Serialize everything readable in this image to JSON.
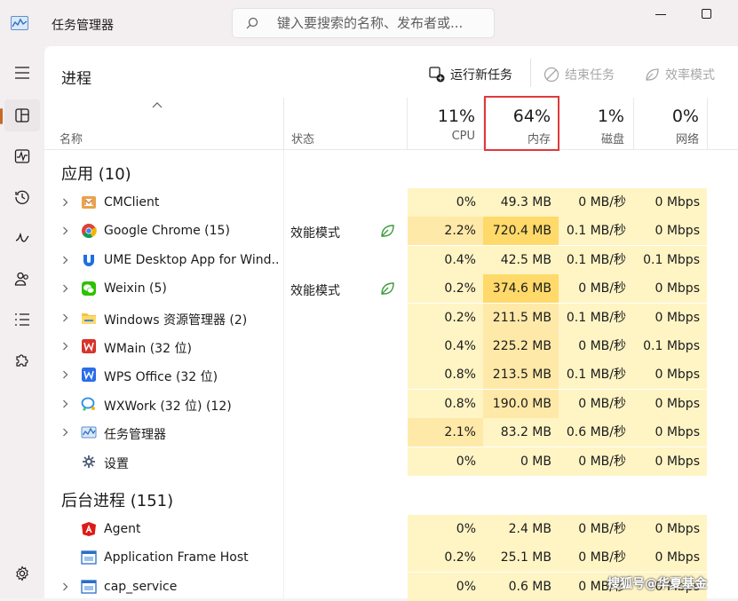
{
  "app": {
    "title": "任务管理器"
  },
  "search": {
    "placeholder": "键入要搜索的名称、发布者或..."
  },
  "page": {
    "title": "进程"
  },
  "commands": {
    "run_new_task": "运行新任务",
    "end_task": "结束任务",
    "efficiency_mode": "效率模式"
  },
  "header": {
    "name": "名称",
    "status": "状态",
    "cpu": {
      "percent": "11%",
      "label": "CPU"
    },
    "memory": {
      "percent": "64%",
      "label": "内存"
    },
    "disk": {
      "percent": "1%",
      "label": "磁盘"
    },
    "network": {
      "percent": "0%",
      "label": "网络"
    }
  },
  "groups": {
    "apps": "应用 (10)",
    "background": "后台进程 (151)"
  },
  "apps": [
    {
      "name": "CMClient",
      "icon": "cmclient-icon",
      "status": "",
      "cpu": "0%",
      "memory": "49.3 MB",
      "disk": "0 MB/秒",
      "network": "0 Mbps"
    },
    {
      "name": "Google Chrome (15)",
      "icon": "chrome-icon",
      "status": "效能模式",
      "cpu": "2.2%",
      "memory": "720.4 MB",
      "disk": "0.1 MB/秒",
      "network": "0 Mbps"
    },
    {
      "name": "UME Desktop App for Wind...",
      "icon": "ume-icon",
      "status": "",
      "cpu": "0.4%",
      "memory": "42.5 MB",
      "disk": "0.1 MB/秒",
      "network": "0.1 Mbps"
    },
    {
      "name": "Weixin (5)",
      "icon": "weixin-icon",
      "status": "效能模式",
      "cpu": "0.2%",
      "memory": "374.6 MB",
      "disk": "0 MB/秒",
      "network": "0 Mbps"
    },
    {
      "name": "Windows 资源管理器 (2)",
      "icon": "explorer-icon",
      "status": "",
      "cpu": "0.2%",
      "memory": "211.5 MB",
      "disk": "0.1 MB/秒",
      "network": "0 Mbps"
    },
    {
      "name": "WMain (32 位)",
      "icon": "wmain-icon",
      "status": "",
      "cpu": "0.4%",
      "memory": "225.2 MB",
      "disk": "0 MB/秒",
      "network": "0.1 Mbps"
    },
    {
      "name": "WPS Office (32 位)",
      "icon": "wps-icon",
      "status": "",
      "cpu": "0.8%",
      "memory": "213.5 MB",
      "disk": "0.1 MB/秒",
      "network": "0 Mbps"
    },
    {
      "name": "WXWork (32 位) (12)",
      "icon": "wxwork-icon",
      "status": "",
      "cpu": "0.8%",
      "memory": "190.0 MB",
      "disk": "0 MB/秒",
      "network": "0 Mbps"
    },
    {
      "name": "任务管理器",
      "icon": "taskmgr-icon",
      "status": "",
      "cpu": "2.1%",
      "memory": "83.2 MB",
      "disk": "0.6 MB/秒",
      "network": "0 Mbps"
    },
    {
      "name": "设置",
      "icon": "settings-app-icon",
      "status": "",
      "cpu": "0%",
      "memory": "0 MB",
      "disk": "0 MB/秒",
      "network": "0 Mbps"
    }
  ],
  "background": [
    {
      "name": "Agent",
      "icon": "agent-icon",
      "status": "",
      "cpu": "0%",
      "memory": "2.4 MB",
      "disk": "0 MB/秒",
      "network": "0 Mbps"
    },
    {
      "name": "Application Frame Host",
      "icon": "frame-host-icon",
      "status": "",
      "cpu": "0.2%",
      "memory": "25.1 MB",
      "disk": "0 MB/秒",
      "network": "0 Mbps"
    },
    {
      "name": "cap_service",
      "icon": "cap-service-icon",
      "status": "",
      "cpu": "0%",
      "memory": "0.6 MB",
      "disk": "0 MB/秒",
      "network": "0 Mbps"
    }
  ],
  "watermark": "搜狐号@华夏基金",
  "colors": {
    "heat_low": "#fff4c4",
    "heat_mid": "#ffe9a8",
    "heat_high": "#ffd969",
    "highlight_border": "#e0393c",
    "accent": "#c46a25"
  }
}
